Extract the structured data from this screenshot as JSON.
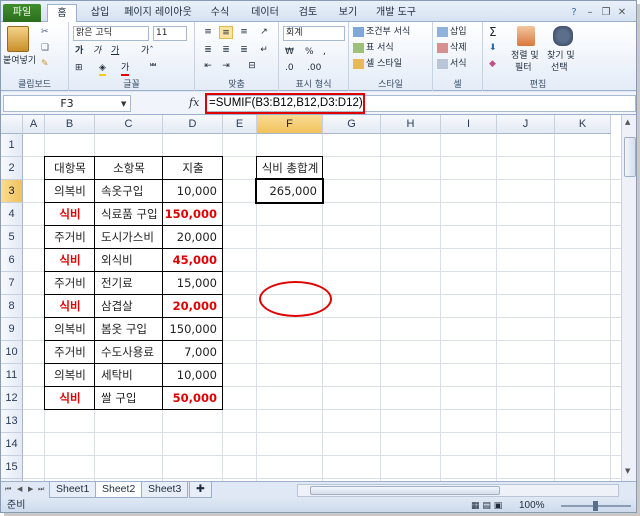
{
  "ribbon_tabs": [
    "파일",
    "홈",
    "삽입",
    "페이지 레이아웃",
    "수식",
    "데이터",
    "검토",
    "보기",
    "개발 도구"
  ],
  "ribbon": {
    "clipboard": {
      "paste": "붙여넣기",
      "label": "클립보드"
    },
    "font": {
      "name": "맑은 고딕",
      "size": "11",
      "label": "글꼴"
    },
    "alignment": {
      "label": "맞춤"
    },
    "number": {
      "format": "회계",
      "label": "표시 형식"
    },
    "styles": {
      "conditional": "조건부 서식",
      "table": "표 서식",
      "cell": "셀 스타일",
      "label": "스타일"
    },
    "cells": {
      "insert": "삽입",
      "delete": "삭제",
      "format": "서식",
      "label": "셀"
    },
    "editing": {
      "sort": "정렬 및",
      "filter": "필터",
      "find": "찾기 및",
      "select": "선택",
      "label": "편집"
    }
  },
  "formula_bar": {
    "name_box": "F3",
    "fx": "fx",
    "formula": "=SUMIF(B3:B12,B12,D3:D12)"
  },
  "columns": [
    "A",
    "B",
    "C",
    "D",
    "E",
    "F",
    "G",
    "H",
    "I",
    "J",
    "K"
  ],
  "rows": [
    "1",
    "2",
    "3",
    "4",
    "5",
    "6",
    "7",
    "8",
    "9",
    "10",
    "11",
    "12",
    "13",
    "14",
    "15",
    "16"
  ],
  "table": {
    "headers": [
      "대항목",
      "소항목",
      "지출"
    ],
    "rows": [
      {
        "b": "의복비",
        "c": "속옷구입",
        "d": "10,000",
        "hl": false
      },
      {
        "b": "식비",
        "c": "식료품 구입",
        "d": "150,000",
        "hl": true
      },
      {
        "b": "주거비",
        "c": "도시가스비",
        "d": "20,000",
        "hl": false
      },
      {
        "b": "식비",
        "c": "외식비",
        "d": "45,000",
        "hl": true
      },
      {
        "b": "주거비",
        "c": "전기료",
        "d": "15,000",
        "hl": false
      },
      {
        "b": "식비",
        "c": "삼겹살",
        "d": "20,000",
        "hl": true
      },
      {
        "b": "의복비",
        "c": "봄옷 구입",
        "d": "150,000",
        "hl": false
      },
      {
        "b": "주거비",
        "c": "수도사용료",
        "d": "7,000",
        "hl": false
      },
      {
        "b": "의복비",
        "c": "세탁비",
        "d": "10,000",
        "hl": false
      },
      {
        "b": "식비",
        "c": "쌀 구입",
        "d": "50,000",
        "hl": true
      }
    ]
  },
  "summary": {
    "label": "식비 총합계",
    "value": "265,000"
  },
  "sheets": [
    "Sheet1",
    "Sheet2",
    "Sheet3"
  ],
  "active_sheet": "Sheet2",
  "status": {
    "mode": "준비",
    "zoom": "100%"
  },
  "colors": {
    "highlight_red": "#e00000",
    "file_tab": "#2f7a20",
    "selection_header": "#f1c15b"
  }
}
